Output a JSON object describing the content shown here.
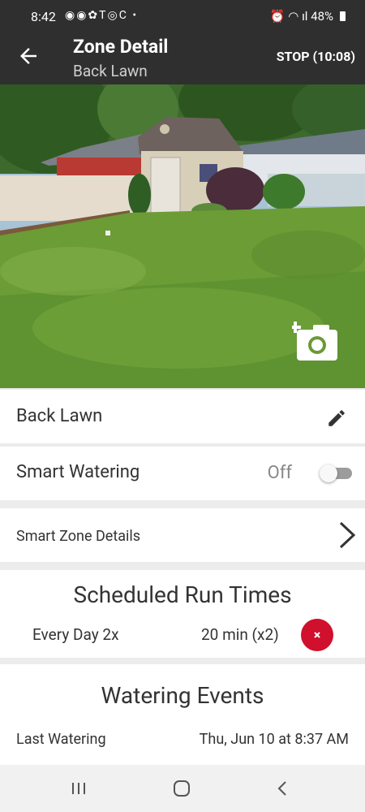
{
  "status_bar": {
    "time": "8:42",
    "left_icons": "◉◉✿T◎C •",
    "right_text": "⏰ ◠ ıl 48%",
    "battery": "48%"
  },
  "app_bar": {
    "title": "Zone Detail",
    "subtitle": "Back Lawn",
    "stop_label": "STOP (10:08)",
    "back_icon": "arrow-left"
  },
  "zone": {
    "name": "Back Lawn",
    "edit_icon": "pencil",
    "photo_action_icon": "add-photo-camera"
  },
  "smart_watering": {
    "label": "Smart Watering",
    "state_label": "Off",
    "enabled": false
  },
  "smart_zone_details": {
    "label": "Smart Zone Details"
  },
  "schedule": {
    "title": "Scheduled Run Times",
    "items": [
      {
        "frequency": "Every Day 2x",
        "duration": "20 min (x2)"
      }
    ],
    "delete_color": "#d0102c"
  },
  "watering_events": {
    "title": "Watering Events",
    "last_label": "Last Watering",
    "last_value": "Thu, Jun 10 at 8:37 AM"
  },
  "colors": {
    "header_bg": "#2f2f2f",
    "accent_red": "#d0102c",
    "page_bg": "#ececec"
  }
}
